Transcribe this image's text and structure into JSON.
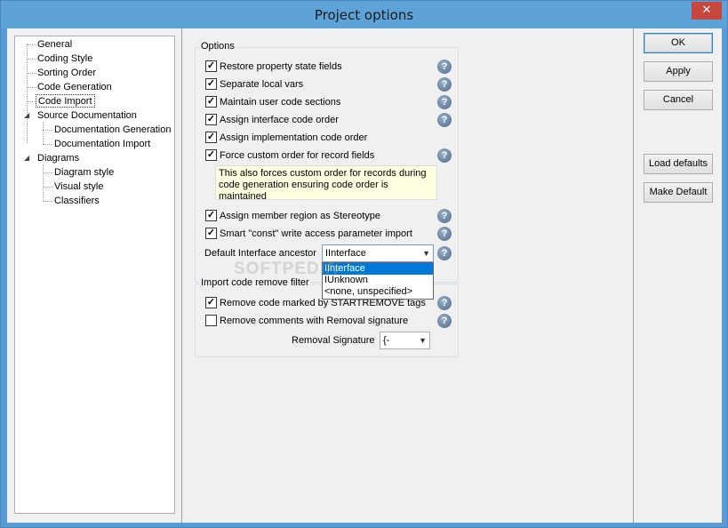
{
  "window": {
    "title": "Project options",
    "close_glyph": "✕"
  },
  "tree": {
    "items": [
      {
        "label": "General",
        "level": 1
      },
      {
        "label": "Coding Style",
        "level": 1
      },
      {
        "label": "Sorting Order",
        "level": 1
      },
      {
        "label": "Code Generation",
        "level": 1
      },
      {
        "label": "Code Import",
        "level": 1,
        "selected": true
      },
      {
        "label": "Source Documentation",
        "level": 1,
        "expanded": true
      },
      {
        "label": "Documentation Generation",
        "level": 2
      },
      {
        "label": "Documentation Import",
        "level": 2
      },
      {
        "label": "Diagrams",
        "level": 1,
        "expanded": true
      },
      {
        "label": "Diagram style",
        "level": 2
      },
      {
        "label": "Visual style",
        "level": 2
      },
      {
        "label": "Classifiers",
        "level": 2
      }
    ]
  },
  "options": {
    "group_label": "Options",
    "checkboxes": [
      {
        "label": "Restore property state fields",
        "checked": true,
        "help": true
      },
      {
        "label": "Separate local vars",
        "checked": true,
        "help": true
      },
      {
        "label": "Maintain user code sections",
        "checked": true,
        "help": true
      },
      {
        "label": "Assign interface code order",
        "checked": true,
        "help": true
      },
      {
        "label": "Assign implementation code order",
        "checked": true,
        "help": false
      },
      {
        "label": "Force custom order for record fields",
        "checked": true,
        "help": true
      }
    ],
    "note": "This also forces custom order for records during code generation ensuring code order is maintained",
    "checkboxes2": [
      {
        "label": "Assign member region as Stereotype",
        "checked": true,
        "help": true
      },
      {
        "label": "Smart \"const\" write access parameter import",
        "checked": true,
        "help": true
      }
    ],
    "ancestor_label": "Default Interface ancestor",
    "ancestor_value": "IInterface",
    "ancestor_options": [
      "IInterface",
      "IUnknown",
      "<none, unspecified>"
    ]
  },
  "filter": {
    "group_label": "Import code remove filter",
    "checkboxes": [
      {
        "label": "Remove code marked by STARTREMOVE tags",
        "checked": true,
        "help": true
      },
      {
        "label": "Remove comments with Removal signature",
        "checked": false,
        "help": true
      }
    ],
    "signature_label": "Removal Signature",
    "signature_value": "{-"
  },
  "buttons": {
    "ok": "OK",
    "apply": "Apply",
    "cancel": "Cancel",
    "load_defaults": "Load defaults",
    "make_default": "Make Default"
  },
  "icons": {
    "help": "?",
    "check": "✓",
    "dropdown_arrow": "▼"
  },
  "watermark": "SOFTPEDIA"
}
